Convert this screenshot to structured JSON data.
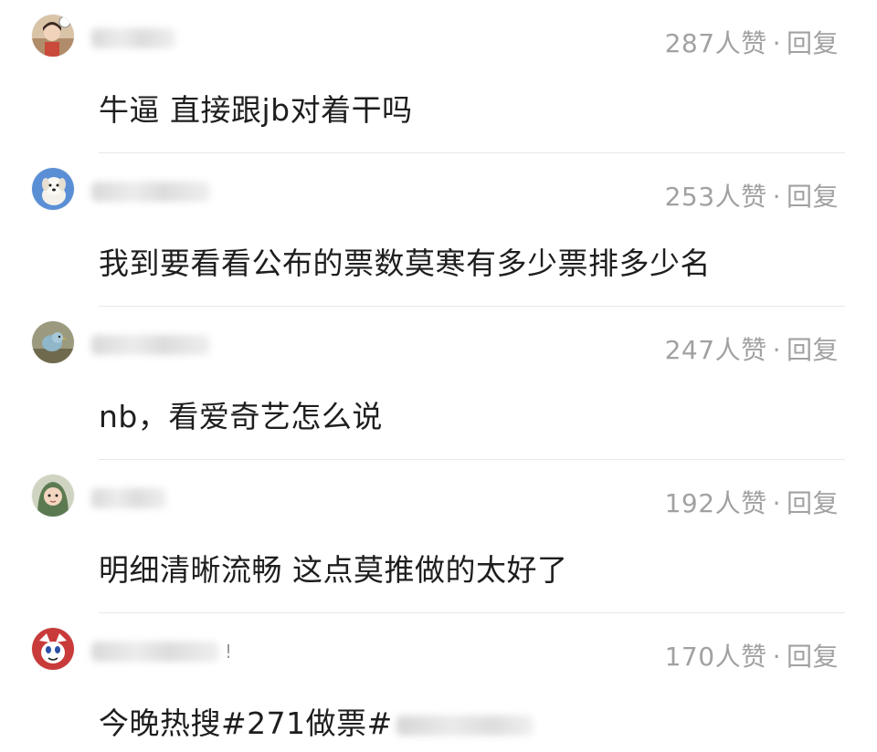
{
  "comments": [
    {
      "likes": "287",
      "likes_suffix": "人赞",
      "separator": "·",
      "reply_label": "回复",
      "text": "牛逼 直接跟jb对着干吗"
    },
    {
      "likes": "253",
      "likes_suffix": "人赞",
      "separator": "·",
      "reply_label": "回复",
      "text": "我到要看看公布的票数莫寒有多少票排多少名"
    },
    {
      "likes": "247",
      "likes_suffix": "人赞",
      "separator": "·",
      "reply_label": "回复",
      "text": "nb，看爱奇艺怎么说"
    },
    {
      "likes": "192",
      "likes_suffix": "人赞",
      "separator": "·",
      "reply_label": "回复",
      "text": "明细清晰流畅 这点莫推做的太好了"
    },
    {
      "likes": "170",
      "likes_suffix": "人赞",
      "separator": "·",
      "reply_label": "回复",
      "text": "今晚热搜#271做票#"
    }
  ],
  "colors": {
    "meta_text": "#a1a1a1",
    "body_text": "#1e1e1e",
    "divider": "#e8e8e8",
    "background": "#ffffff"
  }
}
